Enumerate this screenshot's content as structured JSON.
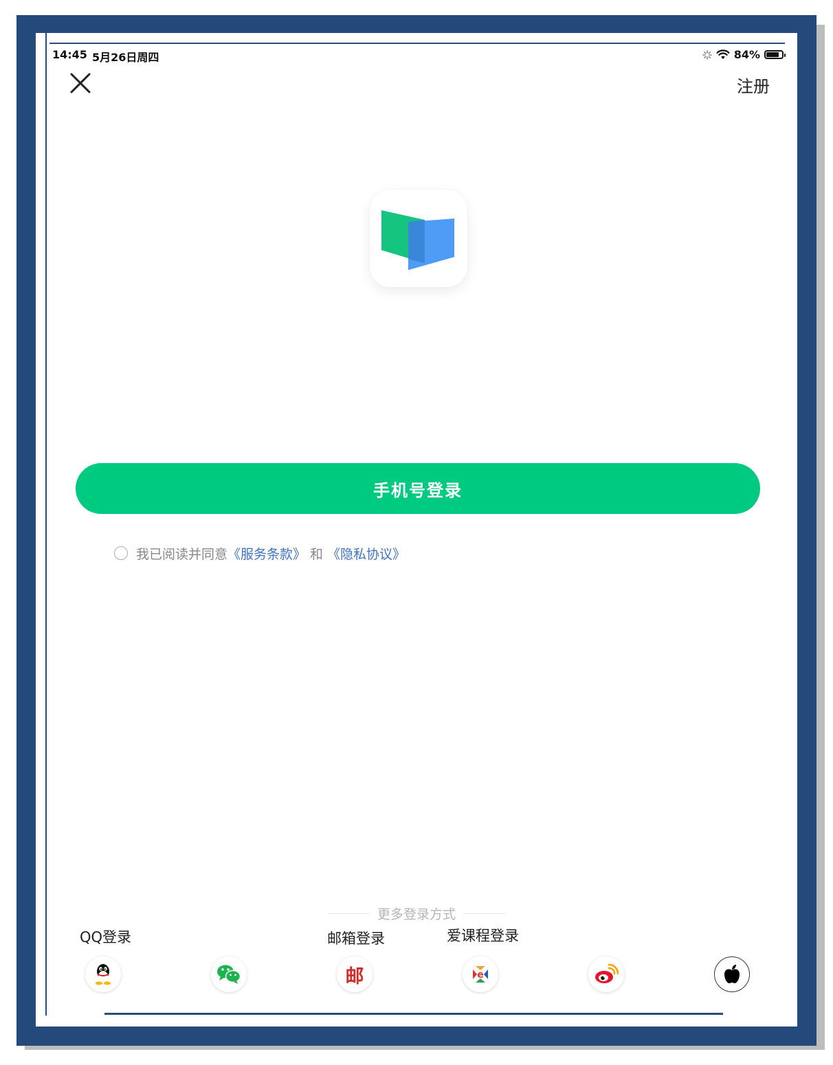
{
  "status_bar": {
    "time": "14:45",
    "date": "5月26日周四",
    "battery_text": "84%",
    "battery_level": 0.84
  },
  "header": {
    "close_icon": "close-icon",
    "register_label": "注册"
  },
  "logo": {
    "icon": "open-book-logo"
  },
  "primary": {
    "phone_login_label": "手机号登录"
  },
  "agreement": {
    "prefix": "我已阅读并同意",
    "terms_link": "《服务条款》",
    "and": "和",
    "privacy_link": "《隐私协议》"
  },
  "more_login": {
    "divider_label": "更多登录方式",
    "labels": {
      "qq": "QQ登录",
      "mail": "邮箱登录",
      "icourse": "爱课程登录"
    },
    "mail_glyph": "邮",
    "icons": [
      "qq-icon",
      "wechat-icon",
      "mail-icon",
      "icourse-icon",
      "weibo-icon",
      "apple-icon"
    ]
  },
  "colors": {
    "primary_green": "#00ca7f",
    "link_blue": "#3f73c4",
    "logo_green": "#15c47e",
    "logo_blue": "#4f9cf7",
    "frame_navy": "#234a7a"
  }
}
